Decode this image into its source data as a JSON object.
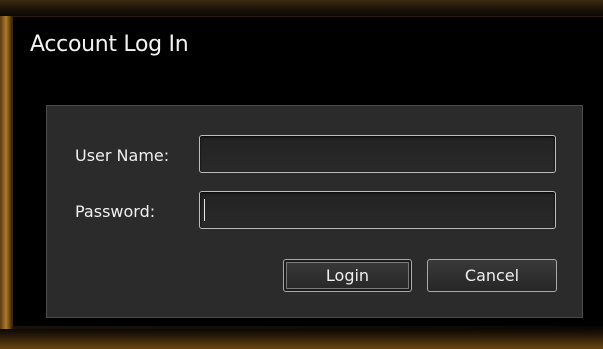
{
  "dialog": {
    "title": "Account Log In",
    "user_name_label": "User Name:",
    "password_label": "Password:",
    "user_name_value": "",
    "password_value": "",
    "login_label": "Login",
    "cancel_label": "Cancel"
  },
  "colors": {
    "background": "#000000",
    "panel": "#2b2b2b",
    "text": "#f0f0f0",
    "frame_accent": "#b07a2a"
  }
}
